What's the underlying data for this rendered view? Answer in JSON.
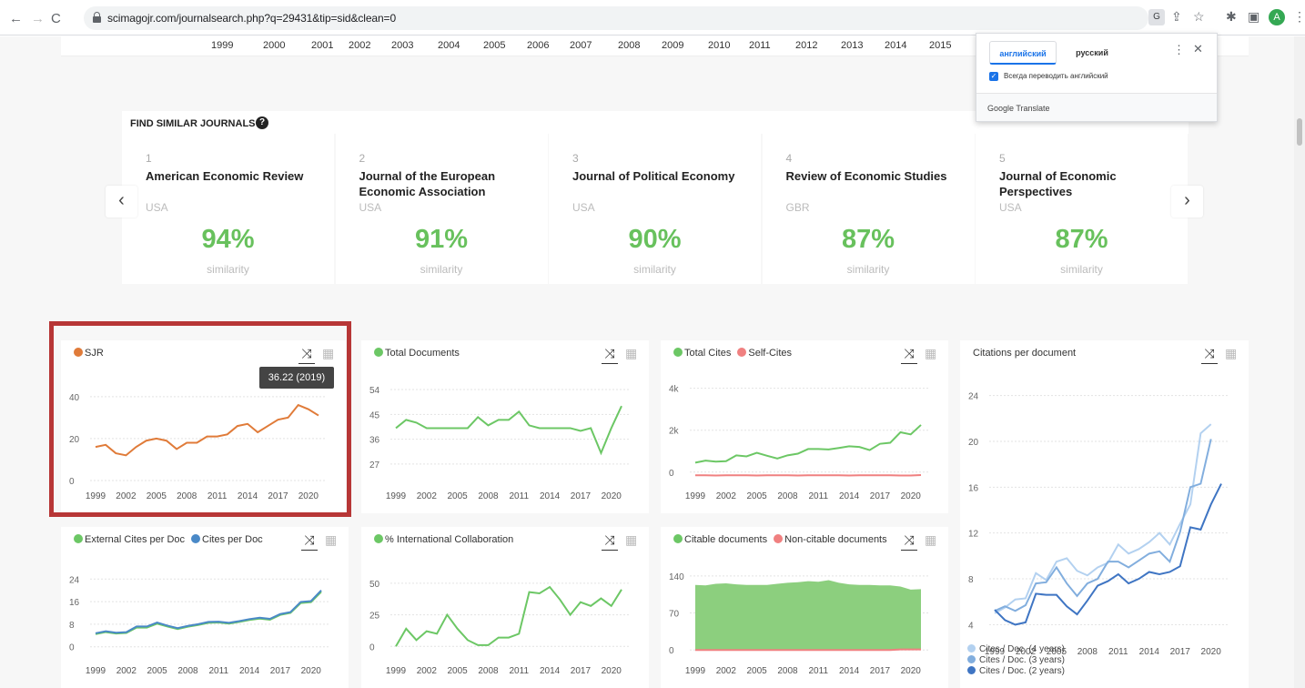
{
  "browser": {
    "url": "scimagojr.com/journalsearch.php?q=29431&tip=sid&clean=0"
  },
  "year_strip": [
    "1999",
    "2000",
    "2001",
    "2002",
    "2003",
    "2004",
    "2005",
    "2006",
    "2007",
    "2008",
    "2009",
    "2010",
    "2011",
    "2012",
    "2013",
    "2014",
    "2015"
  ],
  "translate_popup": {
    "tab_active": "английский",
    "tab_inactive": "русский",
    "checkbox_label": "Всегда переводить английский",
    "footer": "Google Translate"
  },
  "similar": {
    "title": "FIND SIMILAR JOURNALS",
    "similarity_label": "similarity",
    "items": [
      {
        "rank": "1",
        "name": "American Economic Review",
        "country": "USA",
        "percent": "94%"
      },
      {
        "rank": "2",
        "name": "Journal of the European Economic Association",
        "country": "USA",
        "percent": "91%"
      },
      {
        "rank": "3",
        "name": "Journal of Political Economy",
        "country": "USA",
        "percent": "90%"
      },
      {
        "rank": "4",
        "name": "Review of Economic Studies",
        "country": "GBR",
        "percent": "87%"
      },
      {
        "rank": "5",
        "name": "Journal of Economic Perspectives",
        "country": "USA",
        "percent": "87%"
      }
    ]
  },
  "tooltip": "36.22 (2019)",
  "colors": {
    "orange": "#e07b39",
    "green": "#6cc765",
    "red": "#f08080",
    "blue": "#4a89c7",
    "blue_light": "#b3d1f0",
    "blue_mid": "#82aede",
    "blue_dark": "#3f75c3"
  },
  "chart_data": [
    {
      "type": "line",
      "x": [
        1999,
        2000,
        2001,
        2002,
        2003,
        2004,
        2005,
        2006,
        2007,
        2008,
        2009,
        2010,
        2011,
        2012,
        2013,
        2014,
        2015,
        2016,
        2017,
        2018,
        2019,
        2020,
        2021
      ],
      "xticks": [
        "1999",
        "2002",
        "2005",
        "2008",
        "2011",
        "2014",
        "2017",
        "2020"
      ],
      "yticks": [
        "0",
        "20",
        "40"
      ],
      "ylim": [
        0,
        46
      ],
      "series": [
        {
          "name": "SJR",
          "values": [
            16,
            17,
            13,
            12,
            16,
            19,
            20,
            19,
            15,
            18,
            18,
            21,
            21,
            22,
            26,
            27,
            23,
            26,
            29,
            30,
            36,
            34,
            31
          ]
        }
      ]
    },
    {
      "type": "line",
      "x": [
        1999,
        2000,
        2001,
        2002,
        2003,
        2004,
        2005,
        2006,
        2007,
        2008,
        2009,
        2010,
        2011,
        2012,
        2013,
        2014,
        2015,
        2016,
        2017,
        2018,
        2019,
        2020,
        2021
      ],
      "xticks": [
        "1999",
        "2002",
        "2005",
        "2008",
        "2011",
        "2014",
        "2017",
        "2020"
      ],
      "yticks": [
        "27",
        "36",
        "45",
        "54"
      ],
      "ylim": [
        21,
        56
      ],
      "series": [
        {
          "name": "Total Documents",
          "values": [
            40,
            43,
            42,
            40,
            40,
            40,
            40,
            40,
            44,
            41,
            43,
            43,
            46,
            41,
            40,
            40,
            40,
            40,
            39,
            40,
            31,
            40,
            48
          ]
        }
      ]
    },
    {
      "type": "line",
      "x": [
        1999,
        2000,
        2001,
        2002,
        2003,
        2004,
        2005,
        2006,
        2007,
        2008,
        2009,
        2010,
        2011,
        2012,
        2013,
        2014,
        2015,
        2016,
        2017,
        2018,
        2019,
        2020,
        2021
      ],
      "xticks": [
        "1999",
        "2002",
        "2005",
        "2008",
        "2011",
        "2014",
        "2017",
        "2020"
      ],
      "yticks": [
        "0",
        "2k",
        "4k"
      ],
      "ylim": [
        -400,
        4200
      ],
      "series": [
        {
          "name": "Total Cites",
          "values": [
            450,
            550,
            500,
            520,
            800,
            750,
            920,
            780,
            650,
            800,
            880,
            1100,
            1100,
            1080,
            1150,
            1230,
            1200,
            1050,
            1350,
            1400,
            1900,
            1800,
            2250
          ]
        },
        {
          "name": "Self-Cites",
          "values": [
            -150,
            -150,
            -160,
            -150,
            -150,
            -150,
            -160,
            -150,
            -150,
            -150,
            -160,
            -150,
            -150,
            -150,
            -150,
            -160,
            -150,
            -150,
            -150,
            -150,
            -160,
            -160,
            -140
          ]
        }
      ]
    },
    {
      "type": "line",
      "x": [
        1999,
        2000,
        2001,
        2002,
        2003,
        2004,
        2005,
        2006,
        2007,
        2008,
        2009,
        2010,
        2011,
        2012,
        2013,
        2014,
        2015,
        2016,
        2017,
        2018,
        2019,
        2020,
        2021
      ],
      "xticks": [
        "1999",
        "2002",
        "2005",
        "2008",
        "2011",
        "2014",
        "2017",
        "2020"
      ],
      "yticks": [
        "4",
        "8",
        "12",
        "16",
        "20",
        "24"
      ],
      "ylim": [
        3,
        25
      ],
      "series": [
        {
          "name": "Cites / Doc. (4 years)",
          "values": [
            5.0,
            5.5,
            6.2,
            6.3,
            8.5,
            7.9,
            9.5,
            9.8,
            8.7,
            8.3,
            9.0,
            9.4,
            11.0,
            10.2,
            10.6,
            11.2,
            12.0,
            11.0,
            12.8,
            14.5,
            20.7,
            21.5,
            null
          ]
        },
        {
          "name": "Cites / Doc. (3 years)",
          "values": [
            5.2,
            5.6,
            5.2,
            5.7,
            7.6,
            7.7,
            9.0,
            7.6,
            6.5,
            7.6,
            8.0,
            9.5,
            9.5,
            9.0,
            9.6,
            10.2,
            10.4,
            9.5,
            12.1,
            16.0,
            16.3,
            20.2,
            null
          ]
        },
        {
          "name": "Cites / Doc. (2 years)",
          "values": [
            5.3,
            4.4,
            4.0,
            4.2,
            6.7,
            6.6,
            6.6,
            5.6,
            4.9,
            6.1,
            7.4,
            7.8,
            8.4,
            7.6,
            8.0,
            8.6,
            8.4,
            8.6,
            9.1,
            12.5,
            12.3,
            14.5,
            16.3
          ]
        }
      ]
    },
    {
      "type": "line",
      "x": [
        1999,
        2000,
        2001,
        2002,
        2003,
        2004,
        2005,
        2006,
        2007,
        2008,
        2009,
        2010,
        2011,
        2012,
        2013,
        2014,
        2015,
        2016,
        2017,
        2018,
        2019,
        2020,
        2021
      ],
      "xticks": [
        "1999",
        "2002",
        "2005",
        "2008",
        "2011",
        "2014",
        "2017",
        "2020"
      ],
      "yticks": [
        "0",
        "8",
        "16",
        "24"
      ],
      "ylim": [
        -3,
        27
      ],
      "series": [
        {
          "name": "External Cites per Doc",
          "values": [
            4.5,
            5.2,
            4.7,
            4.9,
            6.8,
            6.8,
            8.2,
            7.2,
            6.3,
            7.1,
            7.7,
            8.5,
            8.6,
            8.2,
            8.8,
            9.5,
            10.0,
            9.6,
            11.3,
            12.0,
            15.5,
            15.8,
            19.5
          ]
        },
        {
          "name": "Cites per Doc",
          "values": [
            4.8,
            5.5,
            5.0,
            5.2,
            7.2,
            7.2,
            8.6,
            7.5,
            6.6,
            7.4,
            8.0,
            8.8,
            8.9,
            8.5,
            9.1,
            9.8,
            10.3,
            9.9,
            11.6,
            12.3,
            15.9,
            16.2,
            20.0
          ]
        }
      ]
    },
    {
      "type": "line",
      "x": [
        1999,
        2000,
        2001,
        2002,
        2003,
        2004,
        2005,
        2006,
        2007,
        2008,
        2009,
        2010,
        2011,
        2012,
        2013,
        2014,
        2015,
        2016,
        2017,
        2018,
        2019,
        2020,
        2021
      ],
      "xticks": [
        "1999",
        "2002",
        "2005",
        "2008",
        "2011",
        "2014",
        "2017",
        "2020"
      ],
      "yticks": [
        "0",
        "25",
        "50"
      ],
      "ylim": [
        -7,
        60
      ],
      "series": [
        {
          "name": "% International Collaboration",
          "values": [
            0,
            14,
            5,
            12,
            10,
            25,
            14,
            5,
            1,
            1,
            7,
            7,
            10,
            43,
            42,
            47,
            37,
            25,
            35,
            32,
            38,
            32,
            45
          ]
        }
      ]
    },
    {
      "type": "area",
      "x": [
        1999,
        2000,
        2001,
        2002,
        2003,
        2004,
        2005,
        2006,
        2007,
        2008,
        2009,
        2010,
        2011,
        2012,
        2013,
        2014,
        2015,
        2016,
        2017,
        2018,
        2019,
        2020,
        2021
      ],
      "xticks": [
        "1999",
        "2002",
        "2005",
        "2008",
        "2011",
        "2014",
        "2017",
        "2020"
      ],
      "yticks": [
        "0",
        "70",
        "140"
      ],
      "ylim": [
        -10,
        150
      ],
      "series": [
        {
          "name": "Citable documents",
          "values": [
            123,
            122,
            125,
            126,
            124,
            123,
            123,
            123,
            125,
            127,
            128,
            130,
            129,
            132,
            127,
            124,
            123,
            123,
            122,
            122,
            120,
            114,
            115
          ]
        },
        {
          "name": "Non-citable documents",
          "values": [
            0,
            0,
            0,
            0,
            0,
            0,
            0,
            0,
            0,
            0,
            0,
            0,
            0,
            0,
            0,
            0,
            0,
            0,
            0,
            0,
            1,
            1,
            1
          ]
        }
      ]
    }
  ]
}
